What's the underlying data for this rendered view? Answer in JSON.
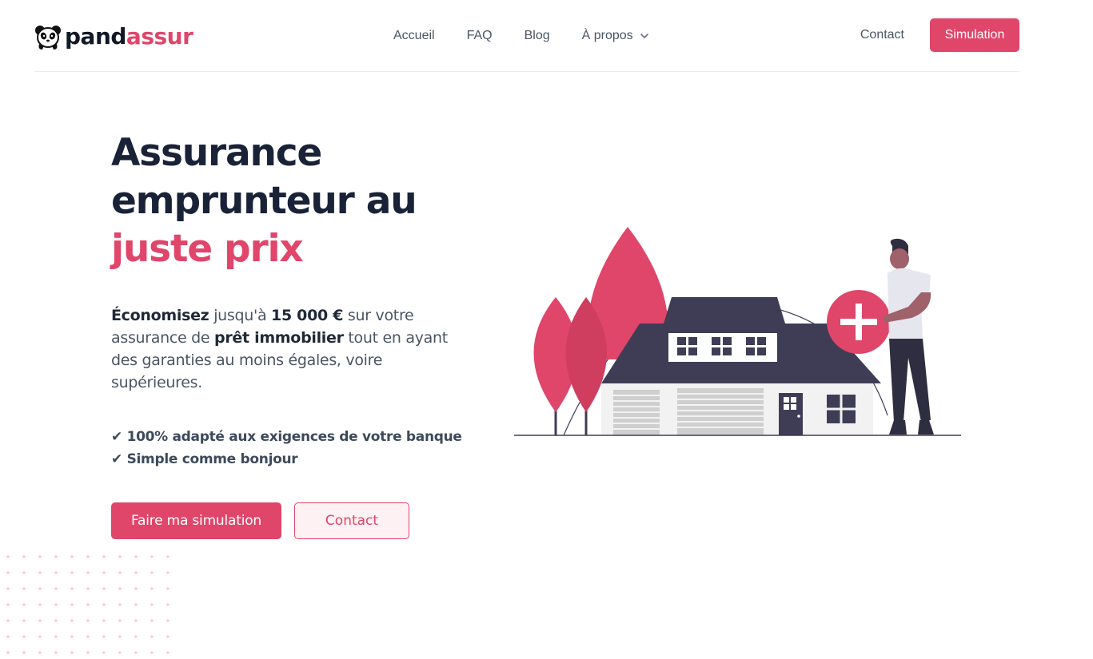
{
  "brand": {
    "name_part1": "pand",
    "name_part2": "assur",
    "accent_color": "#e0456a"
  },
  "nav": {
    "items": [
      {
        "label": "Accueil"
      },
      {
        "label": "FAQ"
      },
      {
        "label": "Blog"
      },
      {
        "label": "À propos"
      }
    ],
    "contact_label": "Contact",
    "simulation_label": "Simulation"
  },
  "hero": {
    "title_line1": "Assurance",
    "title_line2": "emprunteur au",
    "title_highlight": "juste prix",
    "desc": {
      "p1": "Économisez",
      "p2": " jusqu'à ",
      "p3": "15 000 €",
      "p4": " sur votre assurance de ",
      "p5": "prêt immobilier",
      "p6": " tout en ayant des garanties au moins égales, voire supérieures."
    },
    "checks": [
      "✔ 100% adapté aux exigences de votre banque",
      "✔ Simple comme bonjour"
    ],
    "primary_button": "Faire ma simulation",
    "secondary_button": "Contact"
  },
  "icons": {
    "logo": "panda-icon",
    "dropdown": "chevron-down-icon",
    "illustration": "house-with-person-illustration"
  }
}
